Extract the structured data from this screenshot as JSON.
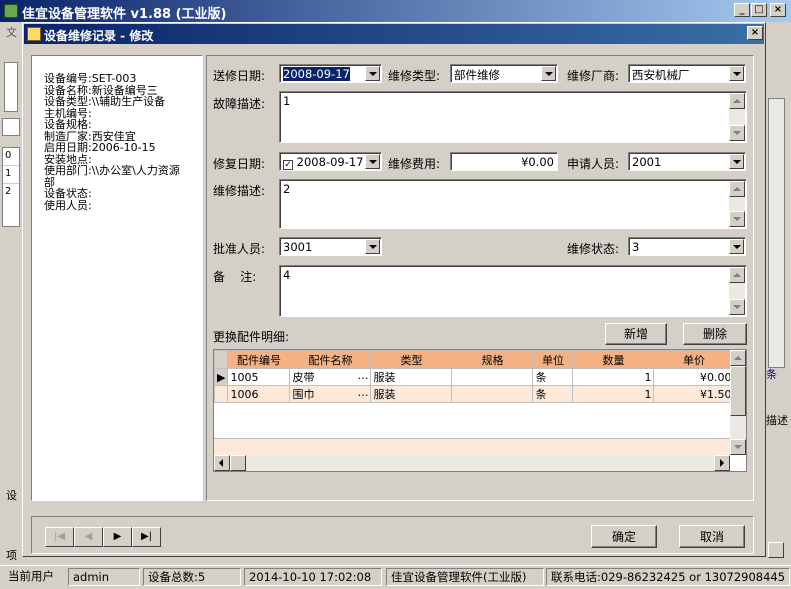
{
  "app": {
    "title": "佳宜设备管理软件 v1.88 (工业版)",
    "min_glyph": "_",
    "max_glyph": "□",
    "close_glyph": "×"
  },
  "background": {
    "menu_fragment": "文",
    "left_rows": [
      "0",
      "1",
      "2"
    ],
    "left_bottom_char_1": "设",
    "left_bottom_char_2": "项",
    "right_text_1": "条",
    "right_text_2": "描述"
  },
  "dialog": {
    "title": "设备维修记录 - 修改",
    "close_glyph": "×"
  },
  "equipment": {
    "lines": [
      "设备编号:SET-003",
      "设备名称:新设备编号三",
      "设备类型:\\\\辅助生产设备",
      "主机编号:",
      "设备规格:",
      "制造厂家:西安佳宜",
      "启用日期:2006-10-15",
      "安装地点:",
      "使用部门:\\\\办公室\\人力资源",
      "部",
      "设备状态:",
      "使用人员:"
    ]
  },
  "form": {
    "send_date_label": "送修日期:",
    "send_date": "2008-09-17",
    "repair_type_label": "维修类型:",
    "repair_type": "部件维修",
    "vendor_label": "维修厂商:",
    "vendor": "西安机械厂",
    "fault_label": "故障描述:",
    "fault": "1",
    "fix_date_label": "修复日期:",
    "fix_date": "2008-09-17",
    "fix_date_checked": true,
    "cost_label": "维修费用:",
    "cost": "¥0.00",
    "applicant_label": "申请人员:",
    "applicant": "2001",
    "repair_desc_label": "维修描述:",
    "repair_desc": "2",
    "approver_label": "批准人员:",
    "approver": "3001",
    "status_label": "维修状态:",
    "status": "3",
    "remark_label": "备    注:",
    "remark": "4"
  },
  "parts": {
    "section_label": "更换配件明细:",
    "add_label": "新增",
    "delete_label": "删除",
    "columns": [
      "配件编号",
      "配件名称",
      "类型",
      "规格",
      "单位",
      "数量",
      "单价"
    ],
    "rows": [
      {
        "code": "1005",
        "name": "皮带",
        "ellipsis": "…",
        "type": "服装",
        "spec": "",
        "unit": "条",
        "qty": "1",
        "price": "¥0.00"
      },
      {
        "code": "1006",
        "name": "围巾",
        "ellipsis": "…",
        "type": "服装",
        "spec": "",
        "unit": "条",
        "qty": "1",
        "price": "¥1.50"
      }
    ]
  },
  "footer": {
    "ok_label": "确定",
    "cancel_label": "取消",
    "nav_first": "|◀",
    "nav_prev": "◀",
    "nav_next": "▶",
    "nav_last": "▶|"
  },
  "statusbar": {
    "user_label": "当前用户",
    "user": "admin",
    "count": "设备总数:5",
    "datetime": "2014-10-10 17:02:08",
    "product": "佳宜设备管理软件(工业版)",
    "contact": "联系电话:029-86232425 or 13072908445"
  }
}
